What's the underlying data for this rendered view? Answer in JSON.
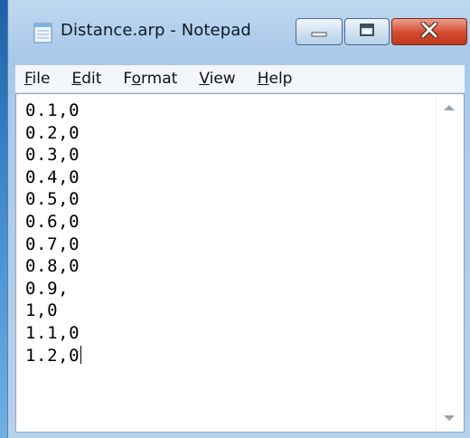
{
  "window": {
    "title": "Distance.arp - Notepad"
  },
  "menubar": {
    "items": [
      {
        "label_u": "F",
        "label_rest": "ile"
      },
      {
        "label_u": "E",
        "label_rest": "dit"
      },
      {
        "label_pre": "F",
        "label_u": "o",
        "label_rest": "rmat"
      },
      {
        "label_u": "V",
        "label_rest": "iew"
      },
      {
        "label_u": "H",
        "label_rest": "elp"
      }
    ]
  },
  "editor": {
    "lines": [
      "0.1,0",
      "0.2,0",
      "0.3,0",
      "0.4,0",
      "0.5,0",
      "0.6,0",
      "0.7,0",
      "0.8,0",
      "0.9,",
      "1,0",
      "1.1,0",
      "1.2,0"
    ]
  },
  "icons": {
    "app": "notepad-icon",
    "minimize": "minimize-icon",
    "maximize": "maximize-icon",
    "close": "close-icon",
    "scroll_up": "scroll-up-arrow-icon",
    "scroll_down": "scroll-down-arrow-icon"
  },
  "colors": {
    "title_bar": "#a9c9ea",
    "close_button": "#c7432a"
  }
}
